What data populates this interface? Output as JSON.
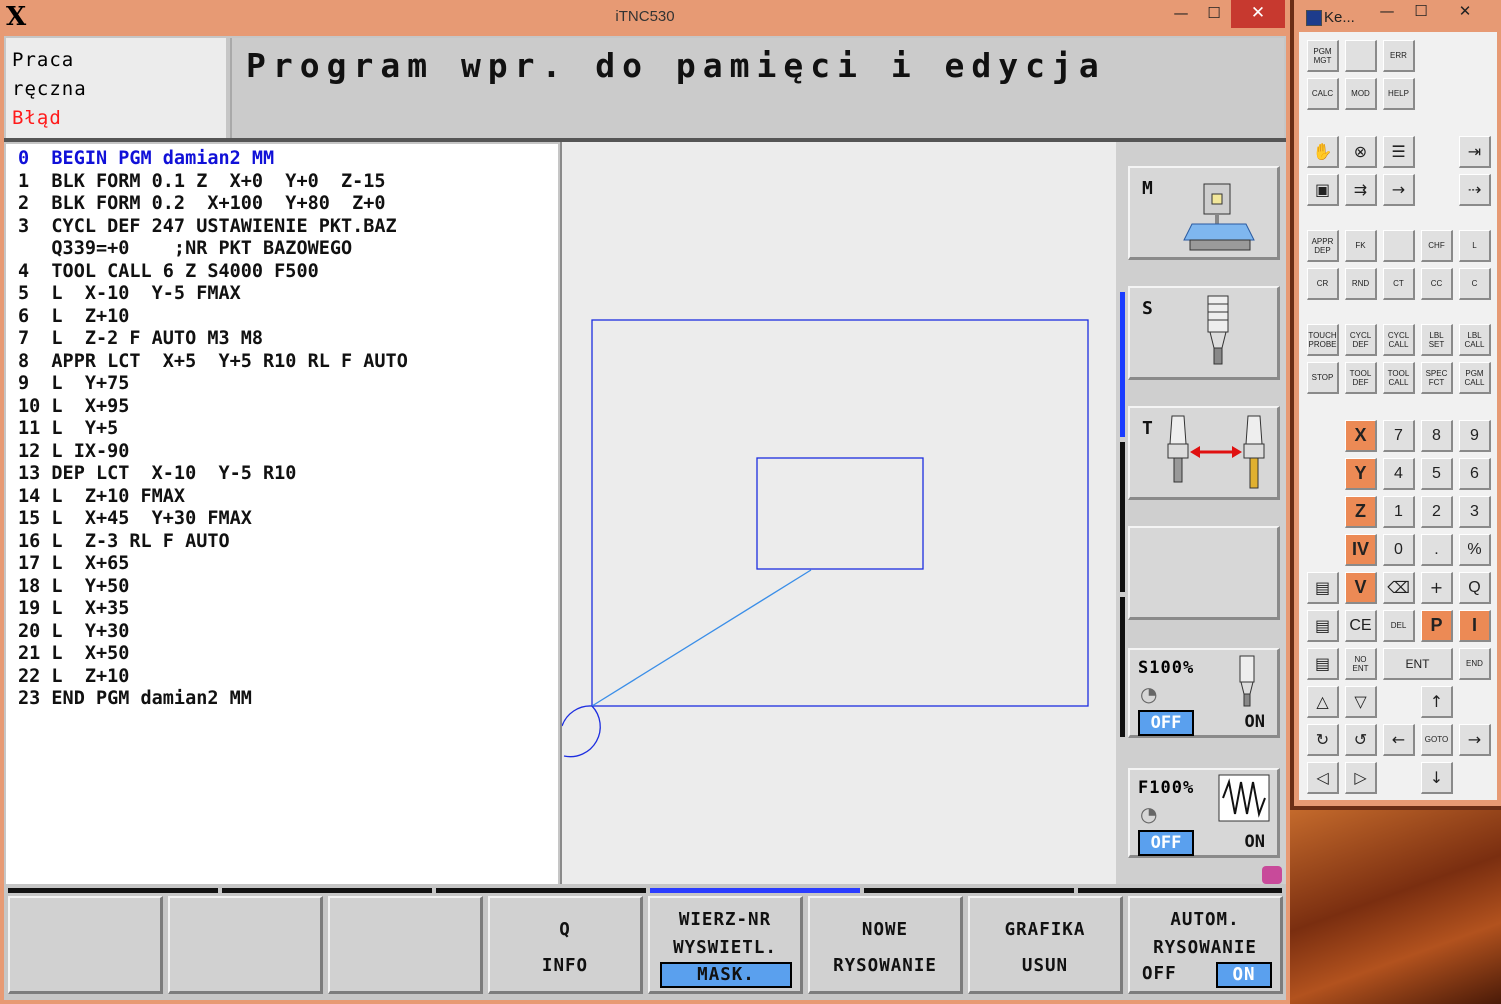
{
  "window": {
    "title": "iTNC530",
    "logo": "X",
    "min": "—",
    "max": "☐",
    "close": "✕"
  },
  "mode": {
    "line1": "Praca",
    "line2": "ręczna",
    "error": "Błąd"
  },
  "headline": "Program wpr. do pamięci i edycja",
  "program": [
    "0  BEGIN PGM damian2 MM",
    "1  BLK FORM 0.1 Z  X+0  Y+0  Z-15",
    "2  BLK FORM 0.2  X+100  Y+80  Z+0",
    "3  CYCL DEF 247 USTAWIENIE PKT.BAZ",
    "   Q339=+0    ;NR PKT BAZOWEGO",
    "4  TOOL CALL 6 Z S4000 F500",
    "5  L  X-10  Y-5 FMAX",
    "6  L  Z+10",
    "7  L  Z-2 F AUTO M3 M8",
    "8  APPR LCT  X+5  Y+5 R10 RL F AUTO",
    "9  L  Y+75",
    "10 L  X+95",
    "11 L  Y+5",
    "12 L IX-90",
    "13 DEP LCT  X-10  Y-5 R10",
    "14 L  Z+10 FMAX",
    "15 L  X+45  Y+30 FMAX",
    "16 L  Z-3 RL F AUTO",
    "17 L  X+65",
    "18 L  Y+50",
    "19 L  X+35",
    "20 L  Y+30",
    "21 L  X+50",
    "22 L  Z+10",
    "23 END PGM damian2 MM"
  ],
  "side": {
    "m": "M",
    "s": "S",
    "t": "T",
    "spindle_override": "S100%",
    "feed_override": "F100%",
    "off": "OFF",
    "on": "ON"
  },
  "softkeys": [
    {
      "l1": "",
      "l2": ""
    },
    {
      "l1": "",
      "l2": ""
    },
    {
      "l1": "",
      "l2": ""
    },
    {
      "l1": "Q",
      "l2": "INFO"
    },
    {
      "l1": "WIERZ-NR",
      "l2": "WYSWIETL.",
      "l3": "MASK."
    },
    {
      "l1": "NOWE",
      "l2": "RYSOWANIE"
    },
    {
      "l1": "GRAFIKA",
      "l2": "USUN"
    },
    {
      "l1": "AUTOM.",
      "l2": "RYSOWANIE",
      "l3a": "OFF",
      "l3b": "ON"
    }
  ],
  "keyboard": {
    "title": "Ke...",
    "row1": [
      "PGM MGT",
      "",
      "ERR"
    ],
    "row2": [
      "CALC",
      "MOD",
      "HELP"
    ],
    "path1": [
      "APPR DEP",
      "FK",
      "",
      "CHF",
      "L"
    ],
    "path2": [
      "CR",
      "RND",
      "CT",
      "CC",
      "C"
    ],
    "cyc1": [
      "TOUCH PROBE",
      "CYCL DEF",
      "CYCL CALL",
      "LBL SET",
      "LBL CALL"
    ],
    "cyc2": [
      "STOP",
      "TOOL DEF",
      "TOOL CALL",
      "SPEC FCT",
      "PGM CALL"
    ],
    "num": [
      [
        "X",
        "7",
        "8",
        "9"
      ],
      [
        "Y",
        "4",
        "5",
        "6"
      ],
      [
        "Z",
        "1",
        "2",
        "3"
      ],
      [
        "IV",
        "0",
        ".",
        "%"
      ]
    ],
    "r_v": [
      "V",
      "Q"
    ],
    "r_ce": [
      "CE",
      "DEL",
      "P",
      "I"
    ],
    "r_ent": [
      "NO ENT",
      "ENT",
      "END"
    ],
    "goto": "GOTO"
  }
}
